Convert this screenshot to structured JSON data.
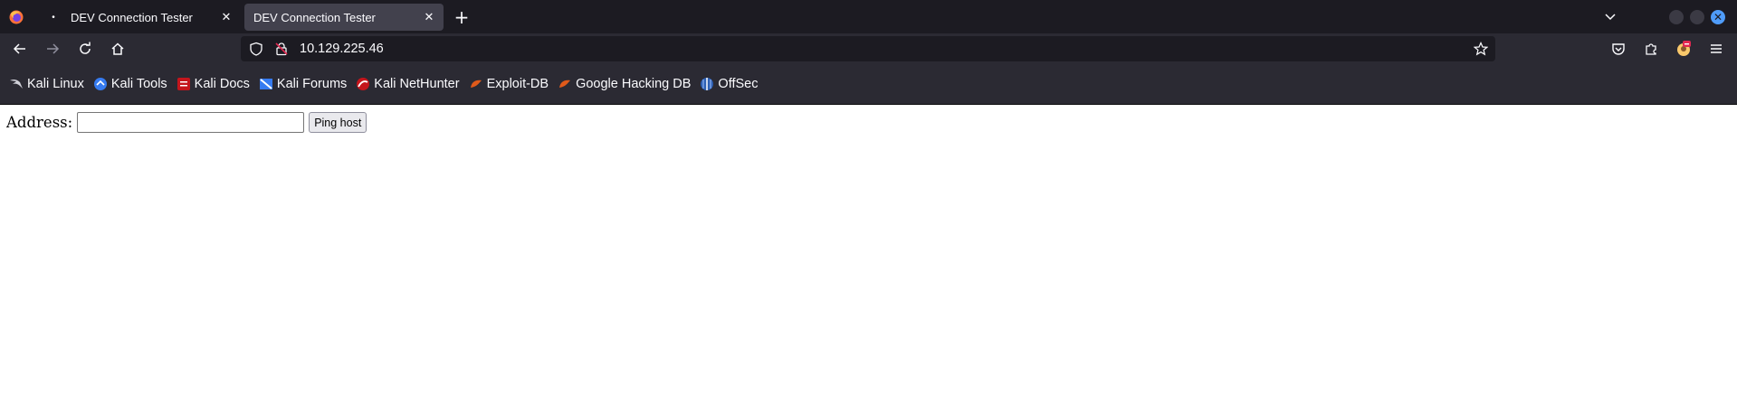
{
  "tabs": [
    {
      "label": "DEV Connection Tester",
      "active": false,
      "indicator": "•"
    },
    {
      "label": "DEV Connection Tester",
      "active": true
    }
  ],
  "tab_close_glyph": "✕",
  "new_tab_glyph": "+",
  "window_close_glyph": "✕",
  "url": "10.129.225.46",
  "bookmarks": [
    {
      "label": "Kali Linux",
      "icon": "kali-dragon-icon"
    },
    {
      "label": "Kali Tools",
      "icon": "kali-tools-icon"
    },
    {
      "label": "Kali Docs",
      "icon": "kali-docs-icon"
    },
    {
      "label": "Kali Forums",
      "icon": "kali-forums-icon"
    },
    {
      "label": "Kali NetHunter",
      "icon": "kali-nethunter-icon"
    },
    {
      "label": "Exploit-DB",
      "icon": "exploit-db-icon"
    },
    {
      "label": "Google Hacking DB",
      "icon": "ghdb-icon"
    },
    {
      "label": "OffSec",
      "icon": "offsec-icon"
    }
  ],
  "form": {
    "label": "Address:",
    "input_value": "",
    "button_label": "Ping host"
  },
  "colors": {
    "tabstrip_bg": "#1c1b22",
    "toolbar_bg": "#2b2a33",
    "active_tab_bg": "#42414d",
    "accent_blue": "#4f9cf9"
  }
}
